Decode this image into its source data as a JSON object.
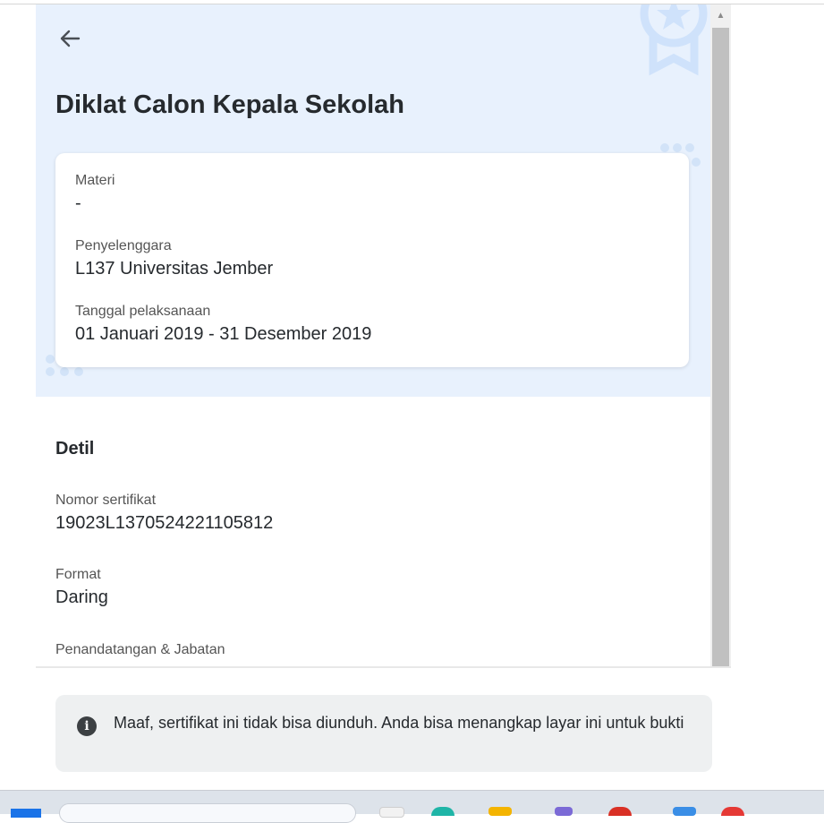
{
  "page": {
    "title": "Diklat Calon Kepala Sekolah"
  },
  "card": {
    "materi": {
      "label": "Materi",
      "value": "-"
    },
    "penyelenggara": {
      "label": "Penyelenggara",
      "value": "L137 Universitas Jember"
    },
    "tanggal": {
      "label": "Tanggal pelaksanaan",
      "value": "01 Januari 2019 - 31 Desember 2019"
    }
  },
  "detail": {
    "heading": "Detil",
    "nomor": {
      "label": "Nomor sertifikat",
      "value": "19023L1370524221105812"
    },
    "format": {
      "label": "Format",
      "value": "Daring"
    },
    "penandatangan": {
      "label": "Penandatangan & Jabatan"
    }
  },
  "notice": {
    "text": "Maaf, sertifikat ini tidak bisa diunduh. Anda bisa menangkap layar ini untuk bukti"
  },
  "icons": [
    "back-arrow-icon",
    "award-badge-icon",
    "info-icon",
    "scroll-up-arrow-icon"
  ],
  "colors": {
    "hero_bg": "#e8f1fd",
    "accent": "#1a73e8",
    "text": "#262a2e"
  }
}
